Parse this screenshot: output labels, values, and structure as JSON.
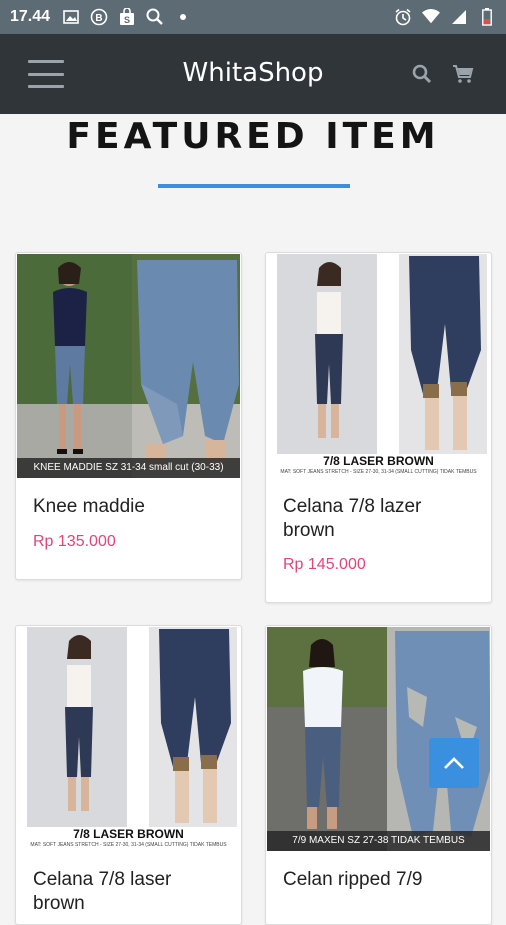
{
  "status": {
    "time": "17.44"
  },
  "app": {
    "title": "WhitaShop"
  },
  "section": {
    "title": "FEATURED ITEM"
  },
  "products": [
    {
      "name": "Knee maddie",
      "price": "Rp 135.000",
      "caption": "KNEE MADDIE SZ 31-34 small cut (30-33)"
    },
    {
      "name": "Celana 7/8 lazer brown",
      "price": "Rp 145.000",
      "caption": "7/8 LASER BROWN",
      "subcaption": "MAT: SOFT JEANS STRETCH - SIZE 27-30, 31-34 (SMALL CUTTING) TIDAK TEMBUS"
    },
    {
      "name": "Celana 7/8 laser brown",
      "price": "",
      "caption": "7/8 LASER BROWN",
      "subcaption": "MAT: SOFT JEANS STRETCH - SIZE 27-30, 31-34 (SMALL CUTTING) TIDAK TEMBUS"
    },
    {
      "name": "Celan ripped 7/9",
      "price": "",
      "caption": "7/9 MAXEN SZ 27-38 TIDAK TEMBUS"
    }
  ]
}
